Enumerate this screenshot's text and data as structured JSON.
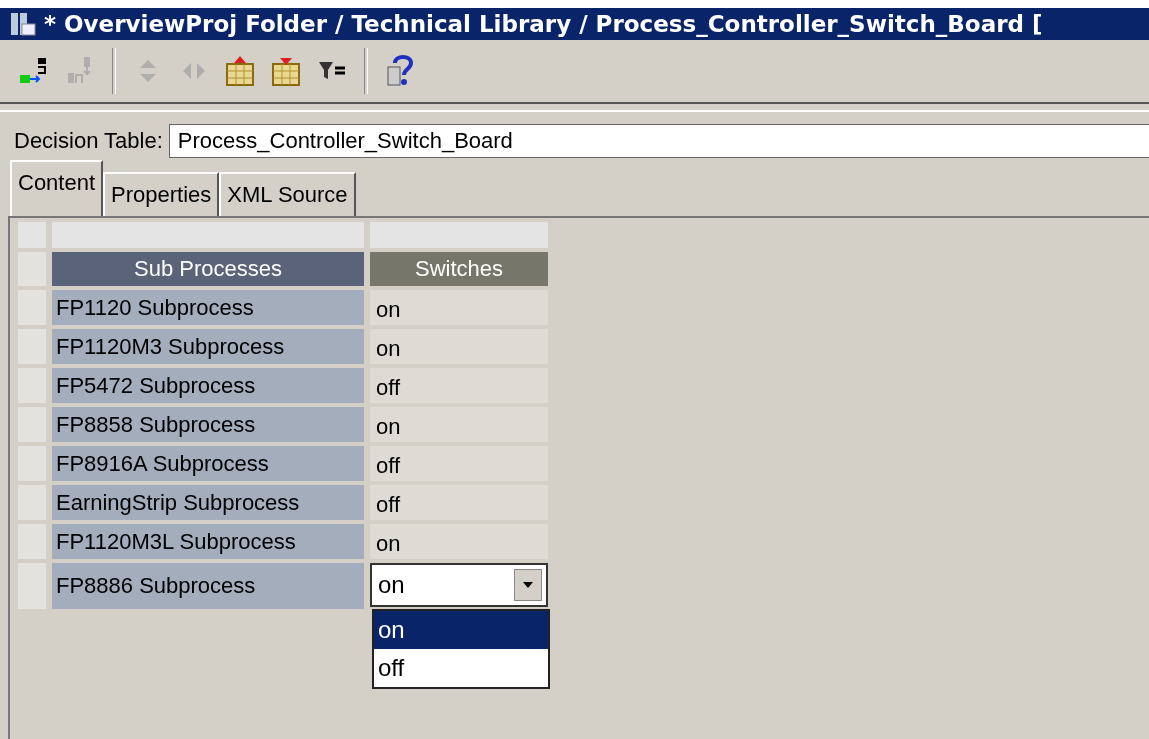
{
  "window": {
    "title": "* OverviewProj Folder / Technical Library / Process_Controller_Switch_Board ["
  },
  "toolbar": [
    {
      "kind": "connect",
      "disabled": false
    },
    {
      "kind": "disconnect",
      "disabled": true
    },
    {
      "kind": "separator"
    },
    {
      "kind": "updown",
      "disabled": true
    },
    {
      "kind": "leftright",
      "disabled": true
    },
    {
      "kind": "table-up",
      "disabled": false
    },
    {
      "kind": "table-down",
      "disabled": false
    },
    {
      "kind": "filter",
      "disabled": false
    },
    {
      "kind": "separator"
    },
    {
      "kind": "help",
      "disabled": false
    }
  ],
  "decision_table": {
    "label": "Decision Table:",
    "value": "Process_Controller_Switch_Board"
  },
  "tabs": [
    {
      "label": "Content",
      "selected": true
    },
    {
      "label": "Properties",
      "selected": false
    },
    {
      "label": "XML Source",
      "selected": false
    }
  ],
  "table": {
    "columns": [
      "Sub Processes",
      "Switches"
    ],
    "rows": [
      {
        "name": "FP1120 Subprocess",
        "value": "on",
        "kind": "text"
      },
      {
        "name": "FP1120M3 Subprocess",
        "value": "on",
        "kind": "text"
      },
      {
        "name": "FP5472 Subprocess",
        "value": "off",
        "kind": "text"
      },
      {
        "name": "FP8858 Subprocess",
        "value": "on",
        "kind": "text"
      },
      {
        "name": "FP8916A Subprocess",
        "value": "off",
        "kind": "text"
      },
      {
        "name": "EarningStrip Subprocess",
        "value": "off",
        "kind": "text"
      },
      {
        "name": "FP1120M3L Subprocess",
        "value": "on",
        "kind": "text"
      },
      {
        "name": "FP8886 Subprocess",
        "value": "on",
        "kind": "combo",
        "options": [
          {
            "label": "on",
            "selected": true
          },
          {
            "label": "off",
            "selected": false
          }
        ]
      }
    ]
  }
}
